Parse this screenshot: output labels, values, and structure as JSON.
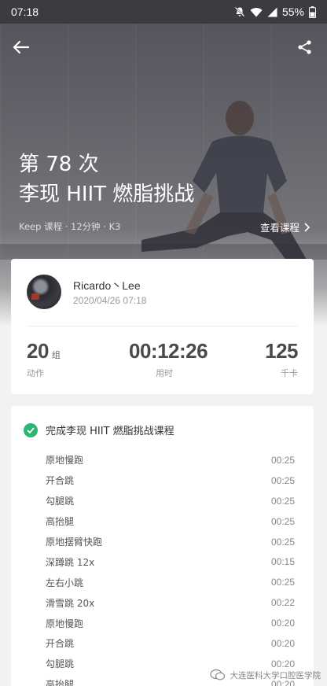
{
  "status_bar": {
    "time": "07:18",
    "battery": "55%"
  },
  "hero": {
    "title_line1": "第 78 次",
    "title_line2": "李现 HIIT 燃脂挑战",
    "meta": "Keep 课程 · 12分钟 · K3",
    "view_course": "查看课程"
  },
  "summary": {
    "user_name": "Ricardo丶Lee",
    "date": "2020/04/26 07:18",
    "actions_value": "20",
    "actions_unit": "组",
    "actions_label": "动作",
    "time_value": "00:12:26",
    "time_label": "用时",
    "calories_value": "125",
    "calories_label": "千卡"
  },
  "completion": {
    "title": "完成李现 HIIT 燃脂挑战课程",
    "exercises": [
      {
        "name": "原地慢跑",
        "duration": "00:25"
      },
      {
        "name": "开合跳",
        "duration": "00:25"
      },
      {
        "name": "勾腿跳",
        "duration": "00:25"
      },
      {
        "name": "高抬腿",
        "duration": "00:25"
      },
      {
        "name": "原地摆臂快跑",
        "duration": "00:25"
      },
      {
        "name": "深蹲跳 12x",
        "duration": "00:15"
      },
      {
        "name": "左右小跳",
        "duration": "00:25"
      },
      {
        "name": "滑雪跳 20x",
        "duration": "00:22"
      },
      {
        "name": "原地慢跑",
        "duration": "00:20"
      },
      {
        "name": "开合跳",
        "duration": "00:20"
      },
      {
        "name": "勾腿跳",
        "duration": "00:20"
      },
      {
        "name": "高抬腿",
        "duration": "00:20"
      }
    ]
  },
  "watermark": {
    "text": "大连医科大学口腔医学院"
  },
  "colors": {
    "accent_green": "#2bb673"
  },
  "icons": {
    "back": "arrow-left-icon",
    "share": "share-icon",
    "check": "check-circle-icon",
    "chevron": "chevron-right-icon"
  }
}
